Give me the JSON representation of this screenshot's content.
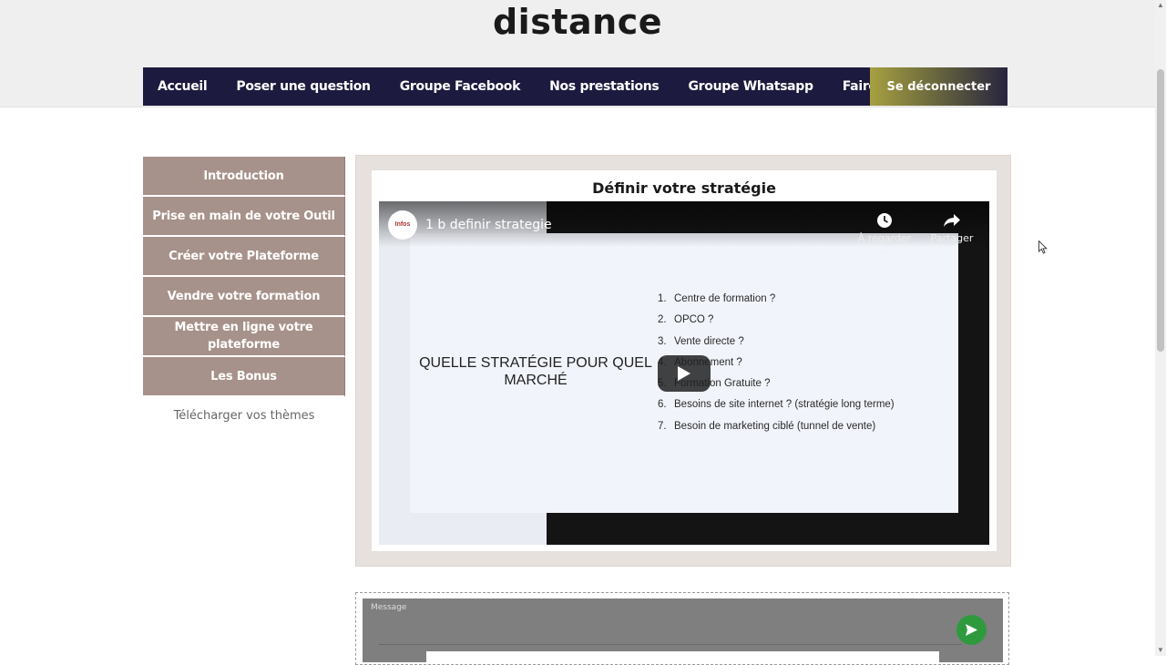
{
  "header": {
    "title": "distance"
  },
  "nav": {
    "items": [
      "Accueil",
      "Poser une question",
      "Groupe Facebook",
      "Nos prestations",
      "Groupe Whatsapp",
      "Faire une sujétion"
    ],
    "logout": "Se déconnecter"
  },
  "sidebar": {
    "items": [
      "Introduction",
      "Prise en main de votre Outil",
      "Créer votre Plateforme",
      "Vendre votre formation",
      "Mettre en ligne votre plateforme",
      "Les Bonus"
    ],
    "download": "Télécharger vos thèmes"
  },
  "lesson": {
    "title": "Définir votre stratégie",
    "video": {
      "title": "1 b definir strategie",
      "channel_avatar_text": "Infos",
      "watch_later": "À regarder ...",
      "share": "Partager",
      "slide_heading": "QUELLE STRATÉGIE POUR QUEL MARCHÉ",
      "slide_items": [
        {
          "num": "1.",
          "text": "Centre de formation ?"
        },
        {
          "num": "2.",
          "text": "OPCO ?"
        },
        {
          "num": "3.",
          "text": "Vente directe ?"
        },
        {
          "num": "4.",
          "text": "Abonnement ?"
        },
        {
          "num": "5.",
          "text": "Formation Gratuite ?"
        },
        {
          "num": "6.",
          "text": "Besoins de site internet ? (stratégie long terme)"
        },
        {
          "num": "7.",
          "text": "Besoin de marketing ciblé (tunnel de vente)"
        }
      ]
    }
  },
  "comment": {
    "label": "Message"
  },
  "colors": {
    "nav_bg": "#1d1a3f",
    "sidebar_bg": "#a6928a",
    "send_button": "#2f9a3d"
  }
}
